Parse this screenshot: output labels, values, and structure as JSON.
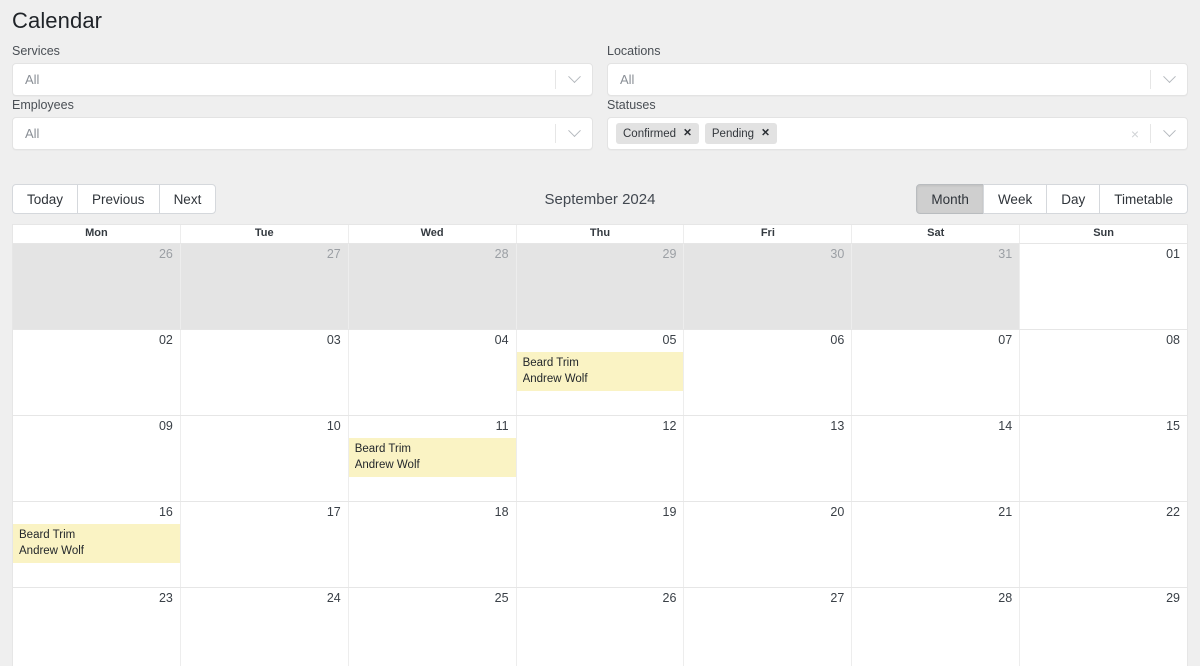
{
  "page_title": "Calendar",
  "filters": [
    {
      "label": "Services",
      "type": "select",
      "value": "All",
      "icon": "chevron-down-icon",
      "name": "services"
    },
    {
      "label": "Locations",
      "type": "select",
      "value": "All",
      "icon": "chevron-down-icon",
      "name": "locations"
    },
    {
      "label": "Employees",
      "type": "select",
      "value": "All",
      "icon": "chevron-down-icon",
      "name": "employees"
    },
    {
      "label": "Statuses",
      "type": "multiselect",
      "value": "",
      "tags": [
        "Confirmed",
        "Pending"
      ],
      "tag_remove_label": "✕",
      "clear_label": "×",
      "icon": "chevron-down-icon",
      "name": "statuses"
    }
  ],
  "toolbar": {
    "nav_buttons": [
      "Today",
      "Previous",
      "Next"
    ],
    "month_title": "September 2024",
    "view_buttons": [
      "Month",
      "Week",
      "Day",
      "Timetable"
    ],
    "active_view": "Month"
  },
  "calendar": {
    "weekday_headers": [
      "Mon",
      "Tue",
      "Wed",
      "Thu",
      "Fri",
      "Sat",
      "Sun"
    ],
    "event_color": "#faf3c4",
    "other_month_color": "#e4e4e4",
    "weeks": [
      [
        {
          "day": "26",
          "other": true,
          "events": []
        },
        {
          "day": "27",
          "other": true,
          "events": []
        },
        {
          "day": "28",
          "other": true,
          "events": []
        },
        {
          "day": "29",
          "other": true,
          "events": []
        },
        {
          "day": "30",
          "other": true,
          "events": []
        },
        {
          "day": "31",
          "other": true,
          "events": []
        },
        {
          "day": "01",
          "other": false,
          "events": []
        }
      ],
      [
        {
          "day": "02",
          "other": false,
          "events": []
        },
        {
          "day": "03",
          "other": false,
          "events": []
        },
        {
          "day": "04",
          "other": false,
          "events": []
        },
        {
          "day": "05",
          "other": false,
          "events": [
            {
              "title": "Beard Trim",
              "person": "Andrew Wolf"
            }
          ]
        },
        {
          "day": "06",
          "other": false,
          "events": []
        },
        {
          "day": "07",
          "other": false,
          "events": []
        },
        {
          "day": "08",
          "other": false,
          "events": []
        }
      ],
      [
        {
          "day": "09",
          "other": false,
          "events": []
        },
        {
          "day": "10",
          "other": false,
          "events": []
        },
        {
          "day": "11",
          "other": false,
          "events": [
            {
              "title": "Beard Trim",
              "person": "Andrew Wolf"
            }
          ]
        },
        {
          "day": "12",
          "other": false,
          "events": []
        },
        {
          "day": "13",
          "other": false,
          "events": []
        },
        {
          "day": "14",
          "other": false,
          "events": []
        },
        {
          "day": "15",
          "other": false,
          "events": []
        }
      ],
      [
        {
          "day": "16",
          "other": false,
          "events": [
            {
              "title": "Beard Trim",
              "person": "Andrew Wolf"
            }
          ]
        },
        {
          "day": "17",
          "other": false,
          "events": []
        },
        {
          "day": "18",
          "other": false,
          "events": []
        },
        {
          "day": "19",
          "other": false,
          "events": []
        },
        {
          "day": "20",
          "other": false,
          "events": []
        },
        {
          "day": "21",
          "other": false,
          "events": []
        },
        {
          "day": "22",
          "other": false,
          "events": []
        }
      ],
      [
        {
          "day": "23",
          "other": false,
          "events": []
        },
        {
          "day": "24",
          "other": false,
          "events": []
        },
        {
          "day": "25",
          "other": false,
          "events": []
        },
        {
          "day": "26",
          "other": false,
          "events": []
        },
        {
          "day": "27",
          "other": false,
          "events": []
        },
        {
          "day": "28",
          "other": false,
          "events": []
        },
        {
          "day": "29",
          "other": false,
          "events": []
        }
      ]
    ]
  }
}
